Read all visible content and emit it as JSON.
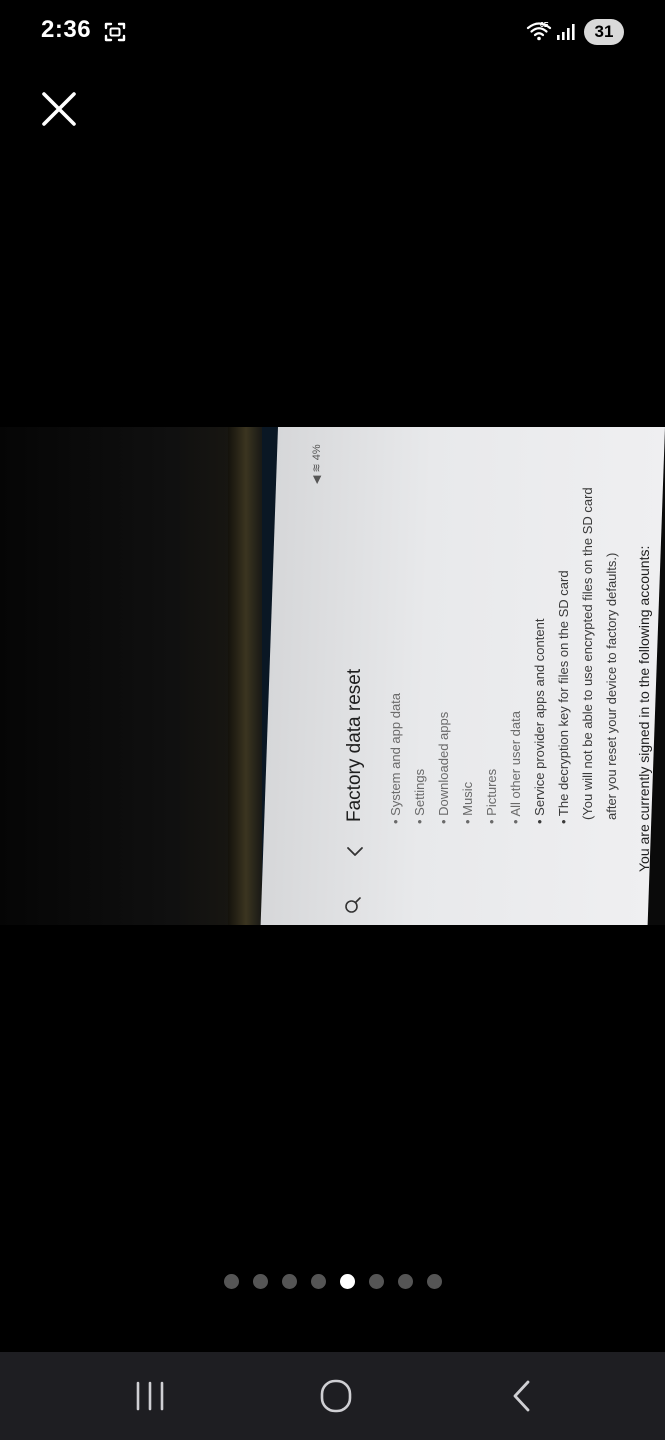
{
  "status_bar": {
    "time": "2:36",
    "battery": "31",
    "icons": [
      "screenshot-icon",
      "wifi-6e-icon",
      "signal-icon"
    ]
  },
  "viewer": {
    "close_icon": "close-icon",
    "pages_total": 8,
    "active_page": 5
  },
  "photo": {
    "status_text": "◀ ≋ 4%",
    "title": "Factory data reset",
    "items": [
      "• System and app data",
      "• Settings",
      "• Downloaded apps",
      "• Music",
      "• Pictures",
      "• All other user data",
      "• Service provider apps and content",
      "• The decryption key for files on the SD card",
      "(You will not be able to use encrypted files on the SD card",
      "after you reset your device to factory defaults.)",
      "You are currently signed in to the following accounts:"
    ]
  },
  "nav_bar": {
    "icons": [
      "recents-icon",
      "home-icon",
      "back-icon"
    ]
  }
}
